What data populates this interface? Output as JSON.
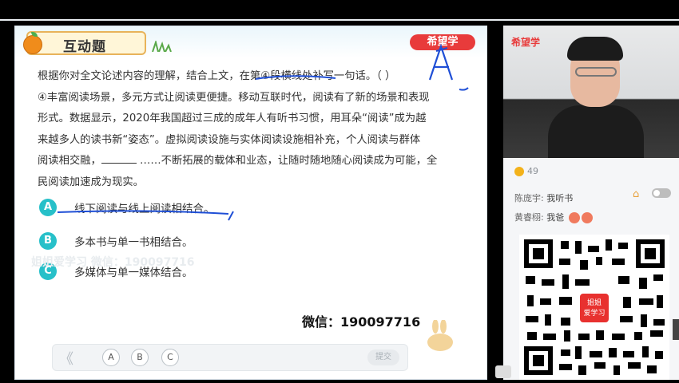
{
  "slide": {
    "title": "互动题",
    "brand": "希望学",
    "question_line1": "根据你对全文论述内容的理解，结合上文，在第④段横线处补写一句话。（      ）",
    "question_line2": "④丰富阅读场景，多元方式让阅读更便捷。移动互联时代，阅读有了新的场景和表现",
    "question_line3": "形式。数据显示，2020年我国超过三成的成年人有听书习惯，用耳朵“阅读”成为越",
    "question_line4": "来越多人的读书新“姿态”。虚拟阅读设施与实体阅读设施相补充，个人阅读与群体",
    "question_line5a": "阅读相交融，",
    "question_line5b": "……不断拓展的载体和业态，让随时随地随心阅读成为可能，全",
    "question_line6": "民阅读加速成为现实。",
    "options": [
      {
        "letter": "A",
        "text": "线下阅读与线上阅读相结合。"
      },
      {
        "letter": "B",
        "text": "多本书与单一书相结合。"
      },
      {
        "letter": "C",
        "text": "多媒体与单一媒体结合。"
      }
    ],
    "watermark1": "姐姐爱学习 微信：190097716",
    "watermark2": "",
    "wechat": "微信：190097716",
    "answer_bar": {
      "prev": "《",
      "buttons": [
        "A",
        "B",
        "C"
      ],
      "submit": "提交"
    }
  },
  "right_panel": {
    "video_brand": "希望学",
    "coins": "49",
    "chat": [
      {
        "name": "陈庞宇:",
        "text": "我听书"
      },
      {
        "name": "黄睿栩:",
        "text": "我爸"
      }
    ],
    "qr_badge_line1": "姐姐",
    "qr_badge_line2": "爱学习"
  },
  "colors": {
    "option_circle": "#27c0c9",
    "brand_red": "#e83b3b",
    "ink_blue": "#1f4fd6"
  }
}
